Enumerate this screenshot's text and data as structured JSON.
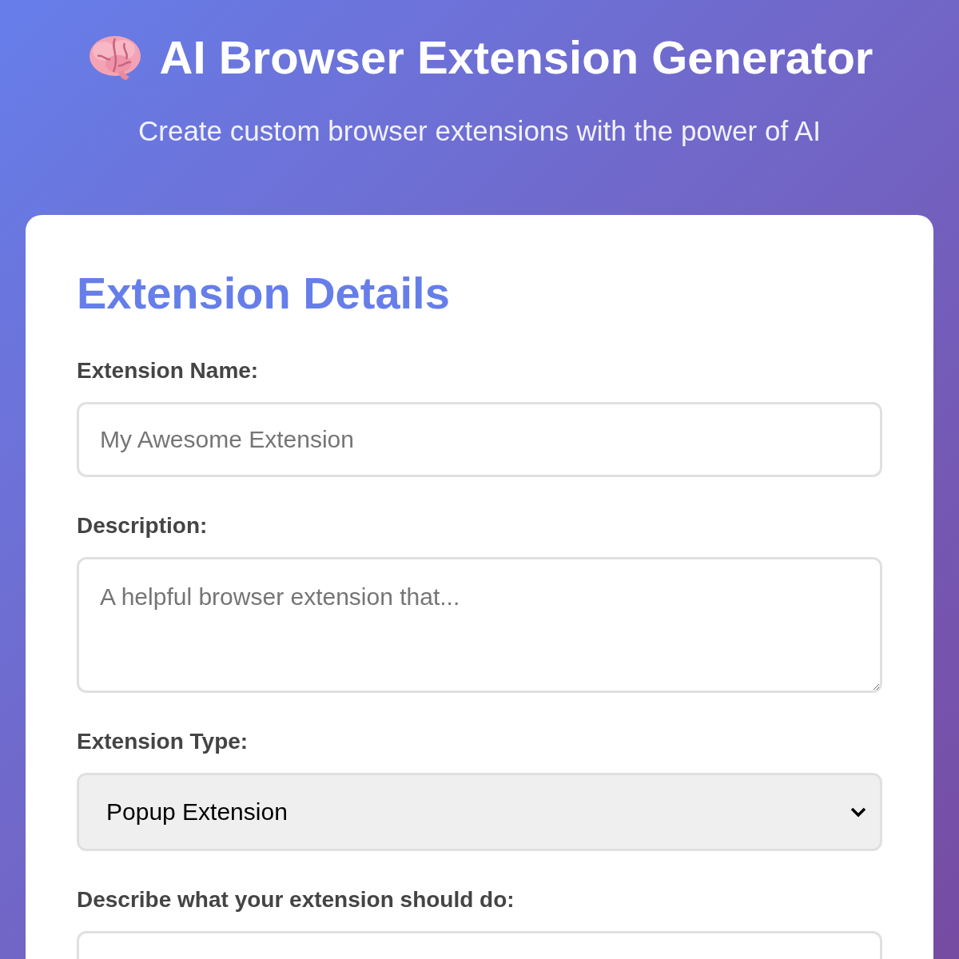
{
  "header": {
    "title": "AI Browser Extension Generator",
    "subtitle": "Create custom browser extensions with the power of AI"
  },
  "card": {
    "heading": "Extension Details",
    "fields": [
      {
        "kind": "input",
        "label": "Extension Name:",
        "placeholder": "My Awesome Extension"
      },
      {
        "kind": "textarea",
        "label": "Description:",
        "placeholder": "A helpful browser extension that..."
      },
      {
        "kind": "select",
        "label": "Extension Type:",
        "value": "Popup Extension"
      },
      {
        "kind": "textarea",
        "label": "Describe what your extension should do:"
      }
    ]
  }
}
